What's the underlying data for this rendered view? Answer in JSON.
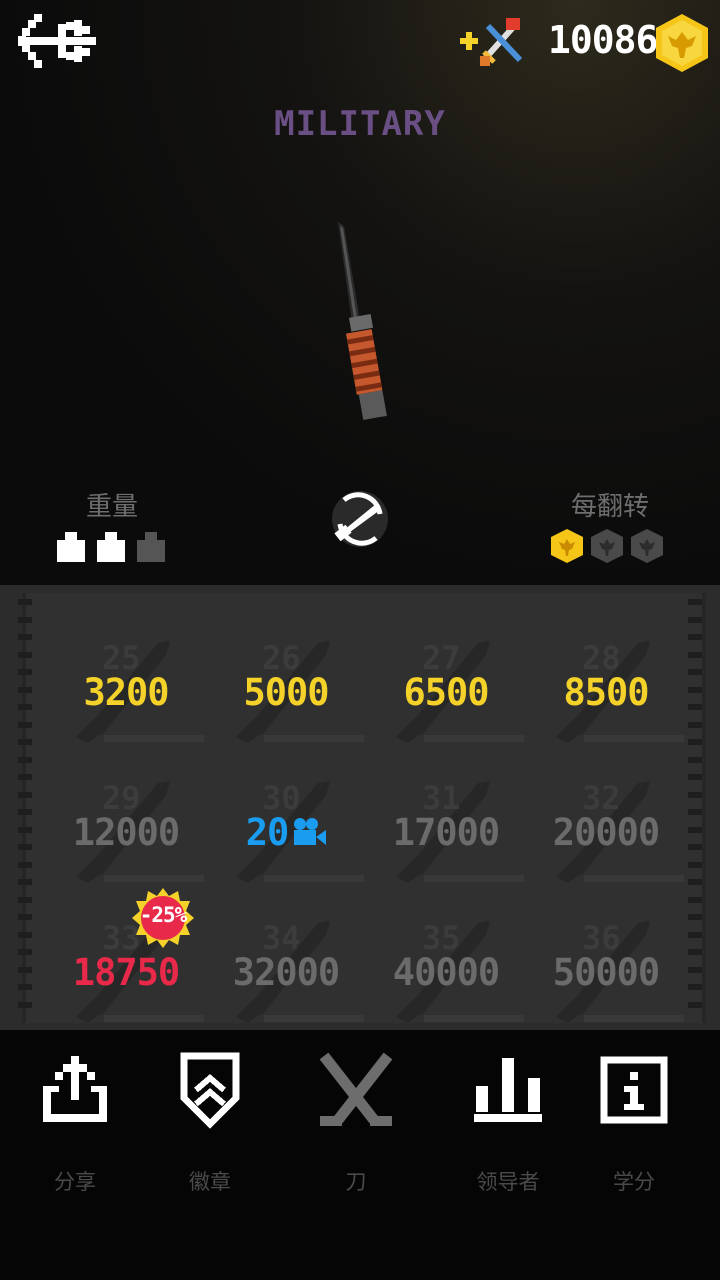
{
  "header": {
    "back_icon": "back-arrow-icon",
    "add_weapon_icon": "crossed-weapons-plus-icon",
    "coins": "10086",
    "coin_icon": "eagle-coin-icon"
  },
  "knife": {
    "name": "MILITARY"
  },
  "stats": {
    "weight_label": "重量",
    "weight_level": 2,
    "weight_max": 3,
    "flip_label": "每翻转",
    "flip_reward": 1,
    "flip_max": 3
  },
  "grid": {
    "items": [
      {
        "number": "25",
        "price": "3200",
        "style": "gold"
      },
      {
        "number": "26",
        "price": "5000",
        "style": "gold"
      },
      {
        "number": "27",
        "price": "6500",
        "style": "gold"
      },
      {
        "number": "28",
        "price": "8500",
        "style": "gold"
      },
      {
        "number": "29",
        "price": "12000",
        "style": "grey"
      },
      {
        "number": "30",
        "price": "20",
        "style": "blue",
        "icon": "video-camera-icon"
      },
      {
        "number": "31",
        "price": "17000",
        "style": "grey"
      },
      {
        "number": "32",
        "price": "20000",
        "style": "grey"
      },
      {
        "number": "33",
        "price": "18750",
        "style": "red",
        "badge": "-25%"
      },
      {
        "number": "34",
        "price": "32000",
        "style": "grey"
      },
      {
        "number": "35",
        "price": "40000",
        "style": "grey"
      },
      {
        "number": "36",
        "price": "50000",
        "style": "grey"
      }
    ]
  },
  "nav": {
    "share": "分享",
    "badges": "徽章",
    "knives": "刀",
    "leaders": "领导者",
    "credits": "学分"
  },
  "colors": {
    "gold": "#f5d22a",
    "purple_title": "#6a4f85",
    "blue": "#1a9cf0",
    "red": "#e8294a"
  }
}
